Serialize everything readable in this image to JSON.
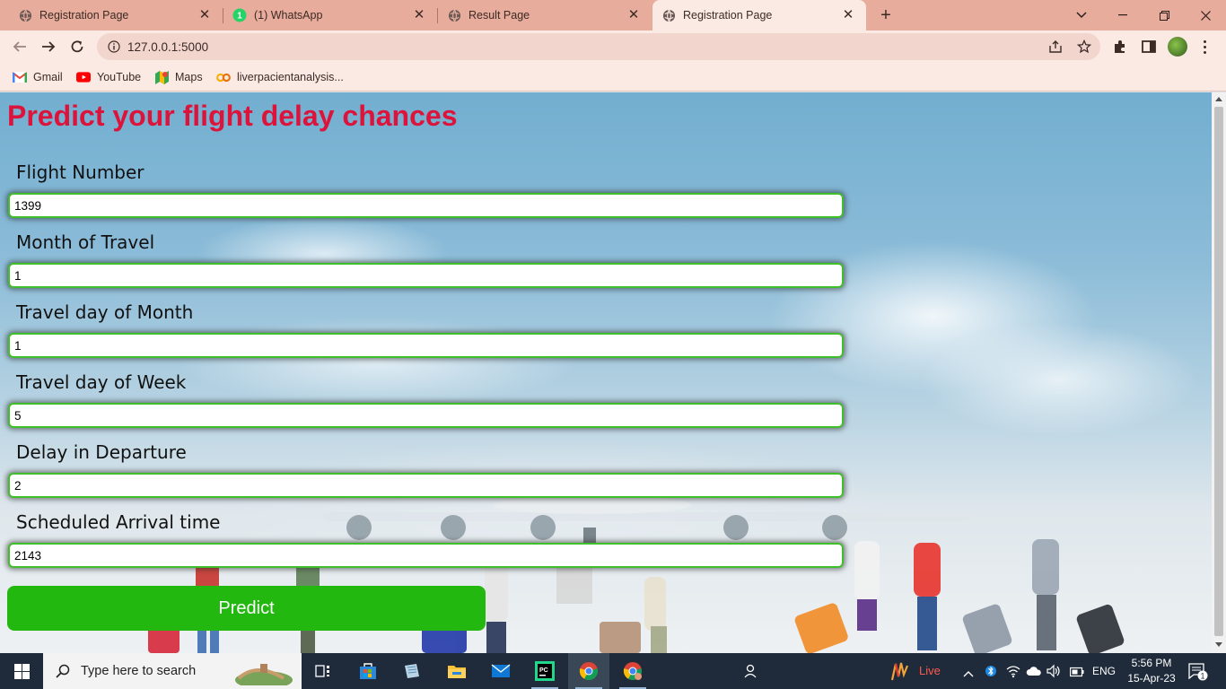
{
  "browser": {
    "tabs": [
      {
        "title": "Registration Page",
        "active": false
      },
      {
        "title": "(1) WhatsApp",
        "active": false,
        "badge": "1"
      },
      {
        "title": "Result Page",
        "active": false
      },
      {
        "title": "Registration Page",
        "active": true
      }
    ],
    "url": "127.0.0.1:5000",
    "bookmarks": [
      {
        "label": "Gmail"
      },
      {
        "label": "YouTube"
      },
      {
        "label": "Maps"
      },
      {
        "label": "liverpacientanalysis..."
      }
    ]
  },
  "page": {
    "title": "Predict your flight delay chances",
    "fields": [
      {
        "label": "Flight Number",
        "value": "1399"
      },
      {
        "label": "Month of Travel",
        "value": "1"
      },
      {
        "label": "Travel day of Month",
        "value": "1"
      },
      {
        "label": "Travel day of Week",
        "value": "5"
      },
      {
        "label": "Delay in Departure",
        "value": "2"
      },
      {
        "label": "Scheduled Arrival time",
        "value": "2143"
      }
    ],
    "submit_label": "Predict"
  },
  "taskbar": {
    "search_placeholder": "Type here to search",
    "live_label": "Live",
    "language": "ENG",
    "time": "5:56 PM",
    "date": "15-Apr-23",
    "notification_count": "1"
  },
  "colors": {
    "title": "#dc143c",
    "button": "#22b80f",
    "input_border": "#3fbf2a",
    "tab_strip": "#e8ac9c",
    "toolbar": "#fbe9e4"
  }
}
